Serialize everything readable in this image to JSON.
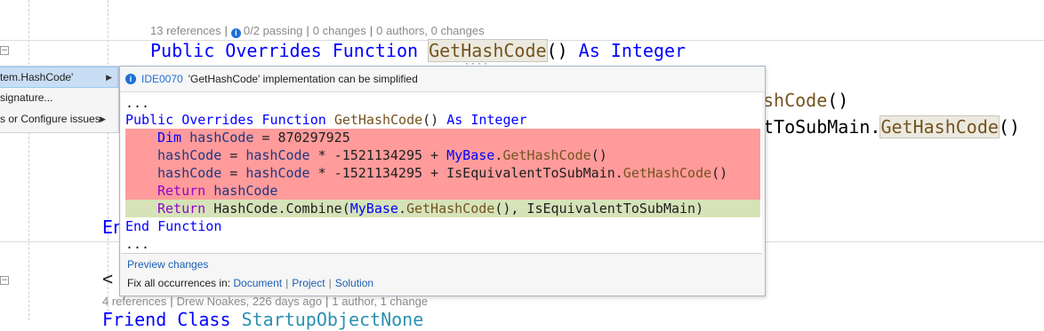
{
  "codelens_top": {
    "references": "13 references",
    "passing": "0/2 passing",
    "changes": "0 changes",
    "authors": "0 authors, 0 changes"
  },
  "code_top": {
    "public_overrides_function": "Public Overrides Function",
    "function_name": "GetHashCode",
    "parens": "()",
    "as_integer": "As Integer"
  },
  "code_right": {
    "line1": "shCode",
    "line1_parens": "()",
    "line2_prefix": "tToSubMain.",
    "line2_fn": "GetHashCode",
    "line2_parens": "()"
  },
  "code_fragments": {
    "end_fragment": "En",
    "attr_fragment": "<",
    "friend_class": "Friend Class",
    "class_name": "StartupObjectNone"
  },
  "codelens_bottom": {
    "references": "4 references",
    "author": "Drew Noakes, 226 days ago",
    "changes": "1 author, 1 change"
  },
  "menu": {
    "items": [
      {
        "label": "tem.HashCode'",
        "has_submenu": true
      },
      {
        "label": "signature...",
        "has_submenu": false
      },
      {
        "label": "s or Configure issues",
        "has_submenu": true
      }
    ]
  },
  "popup": {
    "diagnostic_id": "IDE0070",
    "message": "'GetHashCode' implementation can be simplified",
    "preview": {
      "ellipsis": "...",
      "sig_kw": "Public Overrides Function",
      "sig_fn": "GetHashCode",
      "sig_parens": "()",
      "sig_as": "As Integer",
      "removed": [
        {
          "kw": "Dim",
          "var": "hashCode",
          "rest": " = 870297925"
        },
        {
          "var": "hashCode",
          "mid": " = ",
          "var2": "hashCode",
          "rest": " * -1521134295 + ",
          "type": "MyBase",
          "dot": ".",
          "fn": "GetHashCode",
          "tail": "()"
        },
        {
          "var": "hashCode",
          "mid": " = ",
          "var2": "hashCode",
          "rest": " * -1521134295 + IsEquivalentToSubMain.",
          "fn": "GetHashCode",
          "tail": "()"
        },
        {
          "kw": "Return",
          "var": "hashCode"
        }
      ],
      "added": {
        "kw": "Return",
        "rest": " HashCode.Combine(",
        "type": "MyBase",
        "dot": ".",
        "fn": "GetHashCode",
        "tail": "(), IsEquivalentToSubMain)"
      },
      "end_kw": "End Function",
      "ellipsis_end": "..."
    },
    "preview_changes": "Preview changes",
    "fix_all_label": "Fix all occurrences in:",
    "fix_document": "Document",
    "fix_project": "Project",
    "fix_solution": "Solution"
  }
}
